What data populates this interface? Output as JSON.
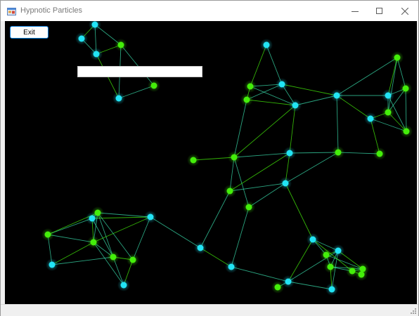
{
  "window": {
    "title": "Hypnotic Particles",
    "controls": [
      "minimize-icon",
      "maximize-icon",
      "close-icon"
    ]
  },
  "toolbar": {
    "exit_label": "Exit",
    "text_field_value": ""
  },
  "colors": {
    "background": "#000000",
    "particle_cyan": "#22e4f5",
    "particle_green": "#44ee0a",
    "link": "#38d8a8"
  }
}
